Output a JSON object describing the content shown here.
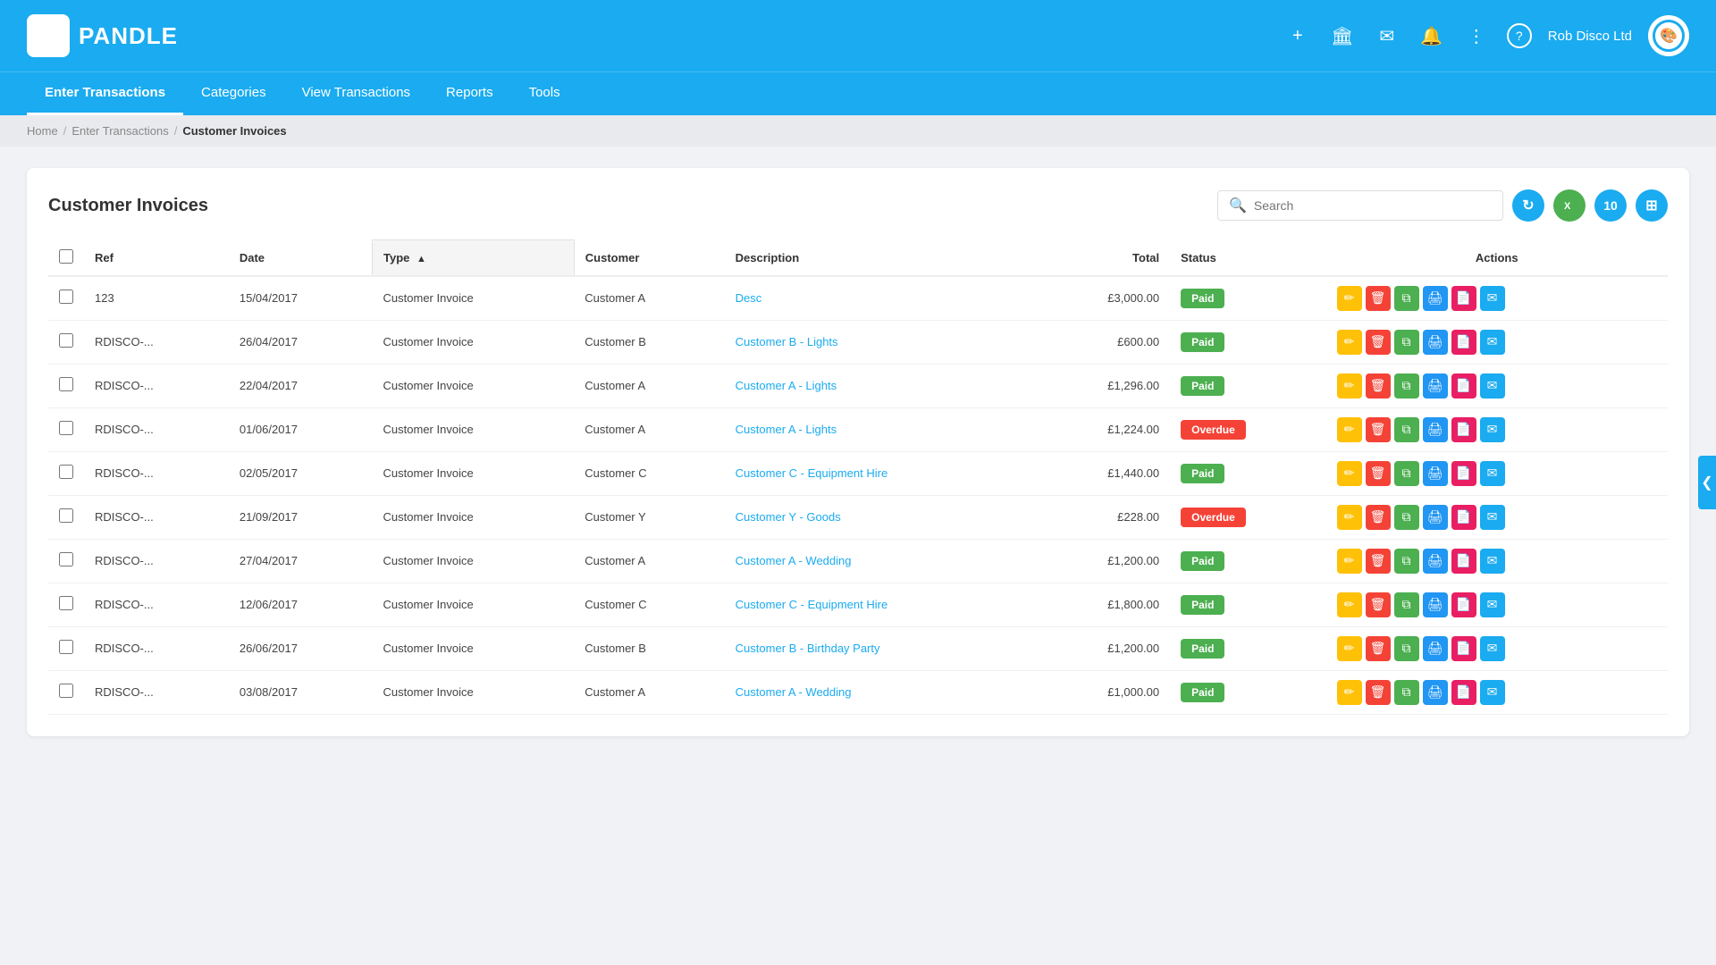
{
  "logo": {
    "icon": "⬡",
    "text": "PANDLE"
  },
  "header": {
    "icons": [
      "+",
      "🏛",
      "✉",
      "🔔",
      "⋮",
      "?"
    ],
    "company": "Rob Disco Ltd",
    "avatar_symbol": "🎨"
  },
  "nav": {
    "items": [
      {
        "label": "Enter Transactions",
        "active": false
      },
      {
        "label": "Categories",
        "active": false
      },
      {
        "label": "View Transactions",
        "active": false
      },
      {
        "label": "Reports",
        "active": false
      },
      {
        "label": "Tools",
        "active": false
      }
    ]
  },
  "breadcrumb": {
    "home": "Home",
    "parent": "Enter Transactions",
    "current": "Customer Invoices"
  },
  "page": {
    "title": "Customer Invoices",
    "search_placeholder": "Search"
  },
  "toolbar": {
    "refresh_title": "Refresh",
    "excel_label": "X",
    "count": "10",
    "grid_symbol": "⊞"
  },
  "table": {
    "columns": [
      "Ref",
      "Date",
      "Type",
      "Customer",
      "Description",
      "Total",
      "Status",
      "Actions"
    ],
    "rows": [
      {
        "ref": "123",
        "date": "15/04/2017",
        "type": "Customer Invoice",
        "customer": "Customer A",
        "description": "Desc",
        "total": "£3,000.00",
        "status": "Paid",
        "status_class": "paid"
      },
      {
        "ref": "RDISCO-...",
        "date": "26/04/2017",
        "type": "Customer Invoice",
        "customer": "Customer B",
        "description": "Customer B - Lights",
        "total": "£600.00",
        "status": "Paid",
        "status_class": "paid"
      },
      {
        "ref": "RDISCO-...",
        "date": "22/04/2017",
        "type": "Customer Invoice",
        "customer": "Customer A",
        "description": "Customer A - Lights",
        "total": "£1,296.00",
        "status": "Paid",
        "status_class": "paid"
      },
      {
        "ref": "RDISCO-...",
        "date": "01/06/2017",
        "type": "Customer Invoice",
        "customer": "Customer A",
        "description": "Customer A - Lights",
        "total": "£1,224.00",
        "status": "Overdue",
        "status_class": "overdue"
      },
      {
        "ref": "RDISCO-...",
        "date": "02/05/2017",
        "type": "Customer Invoice",
        "customer": "Customer C",
        "description": "Customer C - Equipment Hire",
        "total": "£1,440.00",
        "status": "Paid",
        "status_class": "paid"
      },
      {
        "ref": "RDISCO-...",
        "date": "21/09/2017",
        "type": "Customer Invoice",
        "customer": "Customer Y",
        "description": "Customer Y - Goods",
        "total": "£228.00",
        "status": "Overdue",
        "status_class": "overdue"
      },
      {
        "ref": "RDISCO-...",
        "date": "27/04/2017",
        "type": "Customer Invoice",
        "customer": "Customer A",
        "description": "Customer A - Wedding",
        "total": "£1,200.00",
        "status": "Paid",
        "status_class": "paid"
      },
      {
        "ref": "RDISCO-...",
        "date": "12/06/2017",
        "type": "Customer Invoice",
        "customer": "Customer C",
        "description": "Customer C - Equipment Hire",
        "total": "£1,800.00",
        "status": "Paid",
        "status_class": "paid"
      },
      {
        "ref": "RDISCO-...",
        "date": "26/06/2017",
        "type": "Customer Invoice",
        "customer": "Customer B",
        "description": "Customer B - Birthday Party",
        "total": "£1,200.00",
        "status": "Paid",
        "status_class": "paid"
      },
      {
        "ref": "RDISCO-...",
        "date": "03/08/2017",
        "type": "Customer Invoice",
        "customer": "Customer A",
        "description": "Customer A - Wedding",
        "total": "£1,000.00",
        "status": "Paid",
        "status_class": "paid"
      }
    ]
  }
}
